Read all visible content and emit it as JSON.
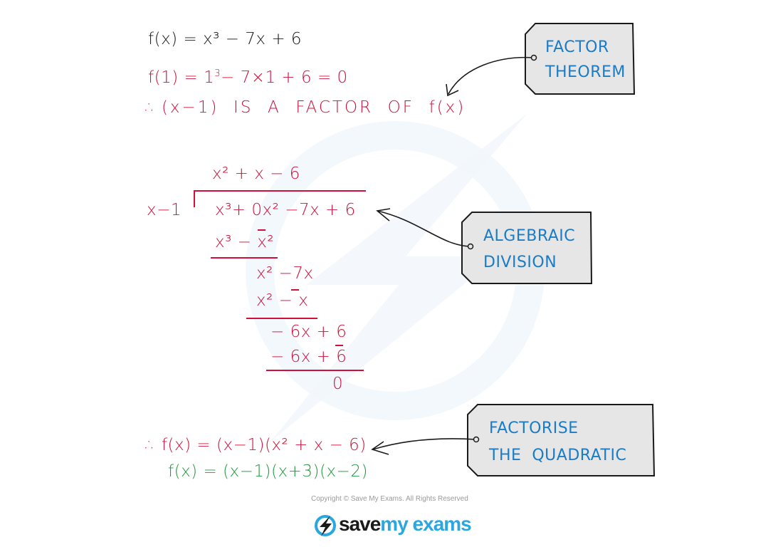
{
  "colors": {
    "given": "#1a1a1a",
    "working": "#d0103a",
    "result": "#1f9a3c",
    "tag_text": "#1a7cc7",
    "tag_fill": "#e6e6e6",
    "brand_dark": "#1a1a1a",
    "brand_accent": "#2aa6e0"
  },
  "given": {
    "function": "f(x) = x³ − 7x + 6"
  },
  "factor_theorem": {
    "evaluation": "f(1) = 1³ − 7×1 + 6 = 0",
    "evaluation_parts": {
      "lhs": "f(1) = 1",
      "exp": "3",
      "rest": "− 7×1 + 6 = 0"
    },
    "therefore_symbol": "∴",
    "conclusion": "(x−1)  IS  A  FACTOR  OF  f(x)"
  },
  "division": {
    "quotient": "x² + x − 6",
    "divisor": "x−1",
    "dividend": "x³+ 0x² −7x + 6",
    "steps": [
      {
        "subtract": "x³ − x²",
        "remainder_line": ""
      },
      {
        "bring_down": "x² −7x"
      },
      {
        "subtract": "x² − x"
      },
      {
        "bring_down": "− 6x + 6"
      },
      {
        "subtract": "− 6x + 6"
      }
    ],
    "remainder": "0",
    "rows": {
      "r1": "x³ − x²",
      "r2": "x² −7x",
      "r3": "x² − x",
      "r4": "− 6x + 6",
      "r5": "− 6x + 6",
      "r6": "0"
    }
  },
  "factorised": {
    "therefore_symbol": "∴",
    "line1": "f(x) = (x−1)(x² + x − 6)",
    "line2": "f(x) = (x−1)(x+3)(x−2)"
  },
  "tags": [
    {
      "line1": "FACTOR",
      "line2": "THEOREM",
      "icon": "tag-icon"
    },
    {
      "line1": "ALGEBRAIC",
      "line2": "DIVISION",
      "icon": "tag-icon"
    },
    {
      "line1": "FACTORISE",
      "line2": "THE  QUADRATIC",
      "icon": "tag-icon"
    }
  ],
  "footer": {
    "copyright": "Copyright © Save My Exams. All Rights Reserved",
    "brand_part1": "save",
    "brand_part2": "my exams",
    "logo_icon": "lightning-bolt-icon"
  }
}
